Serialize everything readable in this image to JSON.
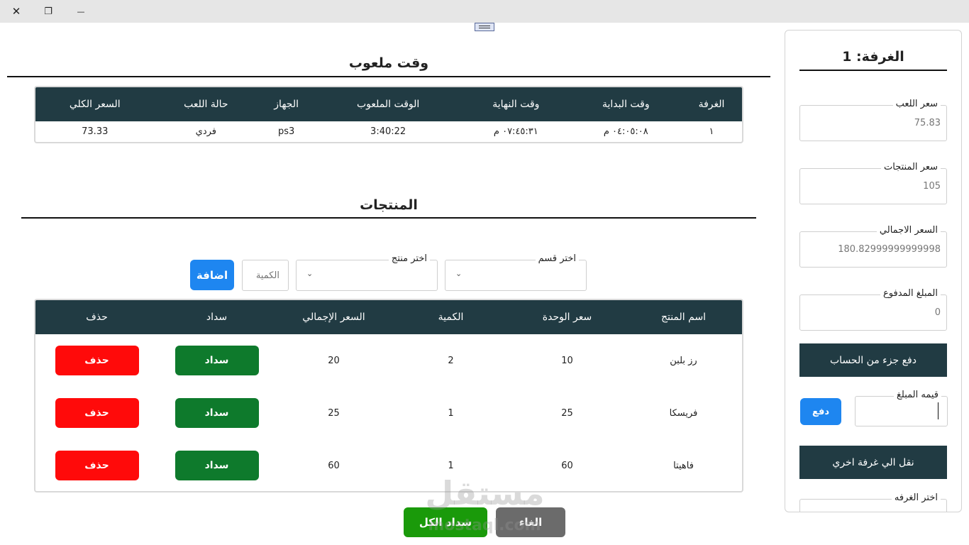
{
  "window": {
    "close_glyph": "✕",
    "restore_glyph": "❐",
    "minimize_glyph": "—"
  },
  "playtime": {
    "title": "وقت ملعوب",
    "headers": [
      "الغرفة",
      "وقت البداية",
      "وقت النهاية",
      "الوقت الملعوب",
      "الجهاز",
      "حالة اللعب",
      "السعر الكلي"
    ],
    "row": [
      "١",
      "٠٤:٠٥:٠٨ م",
      "٠٧:٤٥:٣١ م",
      "3:40:22",
      "ps3",
      "فردي",
      "73.33"
    ]
  },
  "products": {
    "title": "المنتجات",
    "category_label": "اختر قسم",
    "product_label": "اختر منتج",
    "quantity_placeholder": "الكمية",
    "add_label": "اضافة",
    "headers": [
      "اسم المنتج",
      "سعر الوحدة",
      "الكمية",
      "السعر الإجمالي",
      "سداد",
      "حذف"
    ],
    "rows": [
      {
        "name": "رز بلبن",
        "unit": "10",
        "qty": "2",
        "total": "20",
        "pay": "سداد",
        "delete": "حذف"
      },
      {
        "name": "فريسكا",
        "unit": "25",
        "qty": "1",
        "total": "25",
        "pay": "سداد",
        "delete": "حذف"
      },
      {
        "name": "فاهيتا",
        "unit": "60",
        "qty": "1",
        "total": "60",
        "pay": "سداد",
        "delete": "حذف"
      }
    ]
  },
  "footer": {
    "pay_all": "سداد الكل",
    "cancel": "الغاء",
    "watermark": "مستقل",
    "watermark_sub": "mostaql.com"
  },
  "sidebar": {
    "room_title": "الغرفة: 1",
    "play_price_label": "سعر اللعب",
    "play_price": "75.83",
    "products_price_label": "سعر المنتجات",
    "products_price": "105",
    "total_label": "السعر الاجمالي",
    "total": "180.82999999999998",
    "paid_label": "المبلغ المدفوع",
    "paid": "0",
    "partial_pay_label": "دفع جزء من الحساب",
    "amount_label": "قيمه المبلغ",
    "pay_label": "دفع",
    "transfer_label": "نقل الي غرفة اخري",
    "choose_room_label": "اختر الغرفه"
  },
  "colors": {
    "header": "#213b43",
    "green": "#0e7a2c",
    "red": "#ff0a0a",
    "blue": "#1e86f0"
  }
}
